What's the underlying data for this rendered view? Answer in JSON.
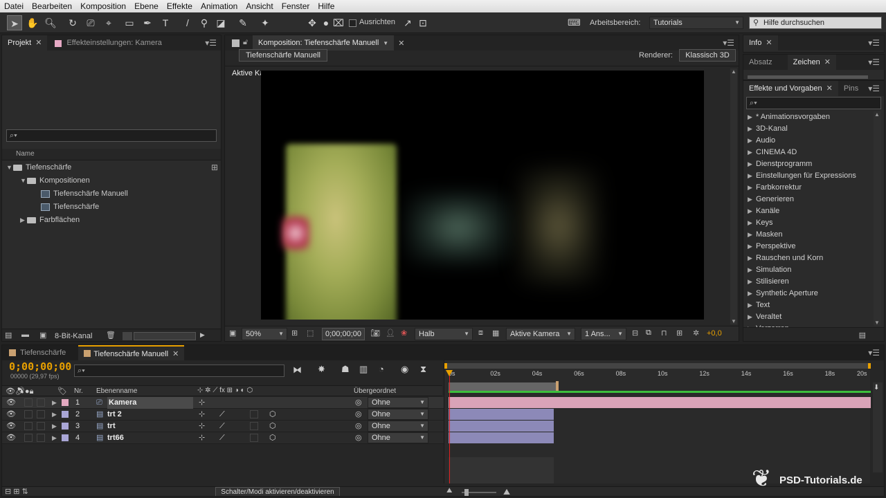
{
  "menu": [
    "Datei",
    "Bearbeiten",
    "Komposition",
    "Ebene",
    "Effekte",
    "Animation",
    "Ansicht",
    "Fenster",
    "Hilfe"
  ],
  "toolbar": {
    "align_label": "Ausrichten",
    "workspace_label": "Arbeitsbereich:",
    "workspace_value": "Tutorials",
    "help_search_placeholder": "Hilfe durchsuchen"
  },
  "project_panel": {
    "tab_project": "Projekt",
    "tab_effects": "Effekteinstellungen: Kamera",
    "search_placeholder": "⌕▾",
    "col_name": "Name",
    "items": [
      {
        "label": "Tiefenschärfe",
        "type": "folder",
        "indent": 0,
        "expanded": true
      },
      {
        "label": "Kompositionen",
        "type": "folder",
        "indent": 1,
        "expanded": true
      },
      {
        "label": "Tiefenschärfe Manuell",
        "type": "comp",
        "indent": 2
      },
      {
        "label": "Tiefenschärfe",
        "type": "comp",
        "indent": 2
      },
      {
        "label": "Farbflächen",
        "type": "folder",
        "indent": 1,
        "expanded": false
      }
    ],
    "bit_depth": "8-Bit-Kanal"
  },
  "composition_panel": {
    "tab_label": "Komposition: Tiefenschärfe Manuell",
    "comp_button": "Tiefenschärfe Manuell",
    "renderer_label": "Renderer:",
    "renderer_value": "Klassisch 3D",
    "view_label": "Aktive Kamera",
    "zoom": "50%",
    "timecode": "0;00;00;00",
    "resolution": "Halb",
    "camera_view": "Aktive Kamera",
    "views": "1 Ans...",
    "exposure": "+0,0"
  },
  "info_panel": {
    "tab": "Info"
  },
  "char_panel": {
    "tab_paragraph": "Absatz",
    "tab_char": "Zeichen"
  },
  "effects_panel": {
    "tab": "Effekte und Vorgaben",
    "tab2": "Pins",
    "search": "⌕▾",
    "items": [
      "* Animationsvorgaben",
      "3D-Kanal",
      "Audio",
      "CINEMA 4D",
      "Dienstprogramm",
      "Einstellungen für Expressions",
      "Farbkorrektur",
      "Generieren",
      "Kanäle",
      "Keys",
      "Masken",
      "Perspektive",
      "Rauschen und Korn",
      "Simulation",
      "Stilisieren",
      "Synthetic Aperture",
      "Text",
      "Veraltet",
      "Verzerren"
    ]
  },
  "timeline": {
    "tab1": "Tiefenschärfe",
    "tab2": "Tiefenschärfe Manuell",
    "timecode": "0;00;00;00",
    "fps": "00000 (29,97 fps)",
    "search": "⌕▾",
    "col_nr": "Nr.",
    "col_name": "Ebenenname",
    "col_parent": "Übergeordnet",
    "ruler": [
      "0s",
      "02s",
      "04s",
      "06s",
      "08s",
      "10s",
      "12s",
      "14s",
      "16s",
      "18s",
      "20s"
    ],
    "layers": [
      {
        "nr": "1",
        "name": "Kamera",
        "parent": "Ohne",
        "color": "#e3a9c0"
      },
      {
        "nr": "2",
        "name": "trt 2",
        "parent": "Ohne",
        "color": "#a9a6d6"
      },
      {
        "nr": "3",
        "name": "trt",
        "parent": "Ohne",
        "color": "#a9a6d6"
      },
      {
        "nr": "4",
        "name": "trt66",
        "parent": "Ohne",
        "color": "#a9a6d6"
      }
    ],
    "toggle_modes": "Schalter/Modi aktivieren/deaktivieren"
  },
  "watermark": "PSD-Tutorials.de",
  "colors": {
    "accent": "#e8a000",
    "camera_track": "#d9a3b8",
    "layer_track": "#8c89b8",
    "playhead": "#e02020"
  }
}
